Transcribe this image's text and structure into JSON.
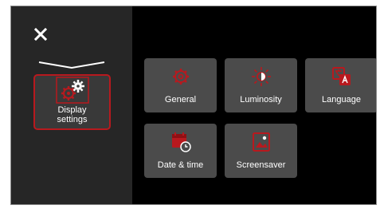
{
  "sidebar": {
    "close_icon": "close-icon",
    "active_item": {
      "label": "Display\nsettings",
      "icon": "display-settings-icon"
    }
  },
  "menu": {
    "tiles": [
      {
        "label": "General",
        "icon": "gear-icon"
      },
      {
        "label": "Luminosity",
        "icon": "brightness-icon"
      },
      {
        "label": "Language",
        "icon": "language-icon"
      },
      {
        "label": "Date & time",
        "icon": "calendar-clock-icon"
      },
      {
        "label": "Screensaver",
        "icon": "screensaver-icon"
      }
    ]
  },
  "colors": {
    "accent": "#b8191e",
    "sidebar_bg": "#262626",
    "tile_bg": "#4b4b4b",
    "panel_bg": "#000000"
  }
}
